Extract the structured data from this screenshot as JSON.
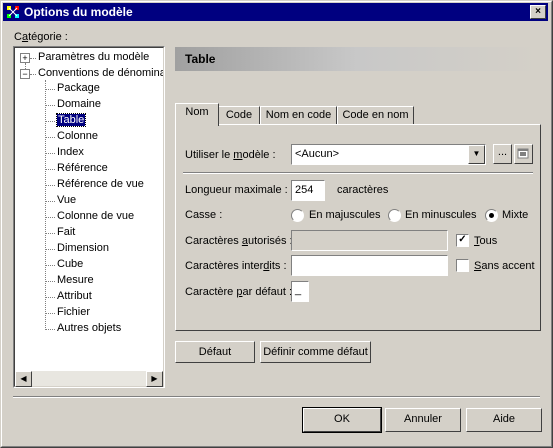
{
  "window": {
    "title": "Options du modèle",
    "close_glyph": "×"
  },
  "category_label_pre": "C",
  "category_label_u": "a",
  "category_label_post": "tégorie :",
  "tree": {
    "root1": "Paramètres du modèle",
    "root2": "Conventions de dénominati",
    "items": [
      "Package",
      "Domaine",
      "Table",
      "Colonne",
      "Index",
      "Référence",
      "Référence de vue",
      "Vue",
      "Colonne de vue",
      "Fait",
      "Dimension",
      "Cube",
      "Mesure",
      "Attribut",
      "Fichier",
      "Autres objets"
    ],
    "selected": "Table"
  },
  "header": {
    "title": "Table"
  },
  "tabs": [
    "Nom",
    "Code",
    "Nom en code",
    "Code en nom"
  ],
  "form": {
    "model_label_pre": "Utiliser le ",
    "model_label_u": "m",
    "model_label_post": "odèle :",
    "model_value": "<Aucun>",
    "ellipsis": "...",
    "maxlen_label": "Longueur maximale :",
    "maxlen_value": "254",
    "maxlen_unit": "caractères",
    "case_label": "Casse :",
    "case_options": [
      "En majuscules",
      "En minuscules",
      "Mixte"
    ],
    "case_selected": "Mixte",
    "allowed_label_pre": "Caractères ",
    "allowed_label_u": "a",
    "allowed_label_post": "utorisés :",
    "allowed_value": "",
    "all_label_pre": "",
    "all_label_u": "T",
    "all_label_post": "ous",
    "forbidden_label_pre": "Caractères inter",
    "forbidden_label_u": "d",
    "forbidden_label_post": "its :",
    "forbidden_value": "",
    "noaccent_label_pre": "",
    "noaccent_label_u": "S",
    "noaccent_label_post": "ans accent",
    "default_char_label_pre": "Caractère ",
    "default_char_label_u": "p",
    "default_char_label_post": "ar défaut :",
    "default_char_value": "_"
  },
  "buttons": {
    "default": "Défaut",
    "set_default": "Définir comme défaut",
    "ok": "OK",
    "cancel": "Annuler",
    "help": "Aide"
  }
}
